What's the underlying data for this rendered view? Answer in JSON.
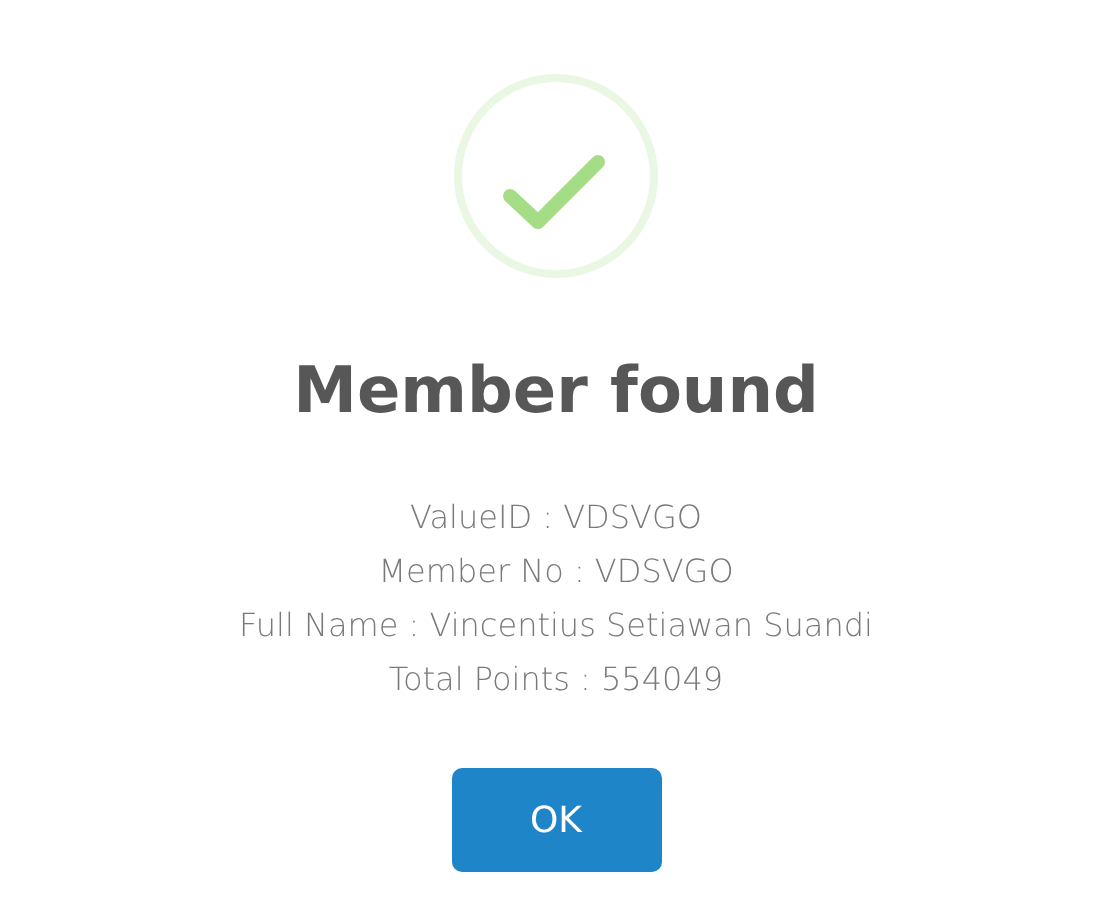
{
  "dialog": {
    "icon": {
      "kind": "success"
    },
    "title": "Member found",
    "lines": [
      "ValueID : VDSVGO",
      "Member No : VDSVGO",
      "Full Name : Vincentius Setiawan Suandi",
      "Total Points : 554049"
    ],
    "buttons": [
      "OK"
    ]
  }
}
